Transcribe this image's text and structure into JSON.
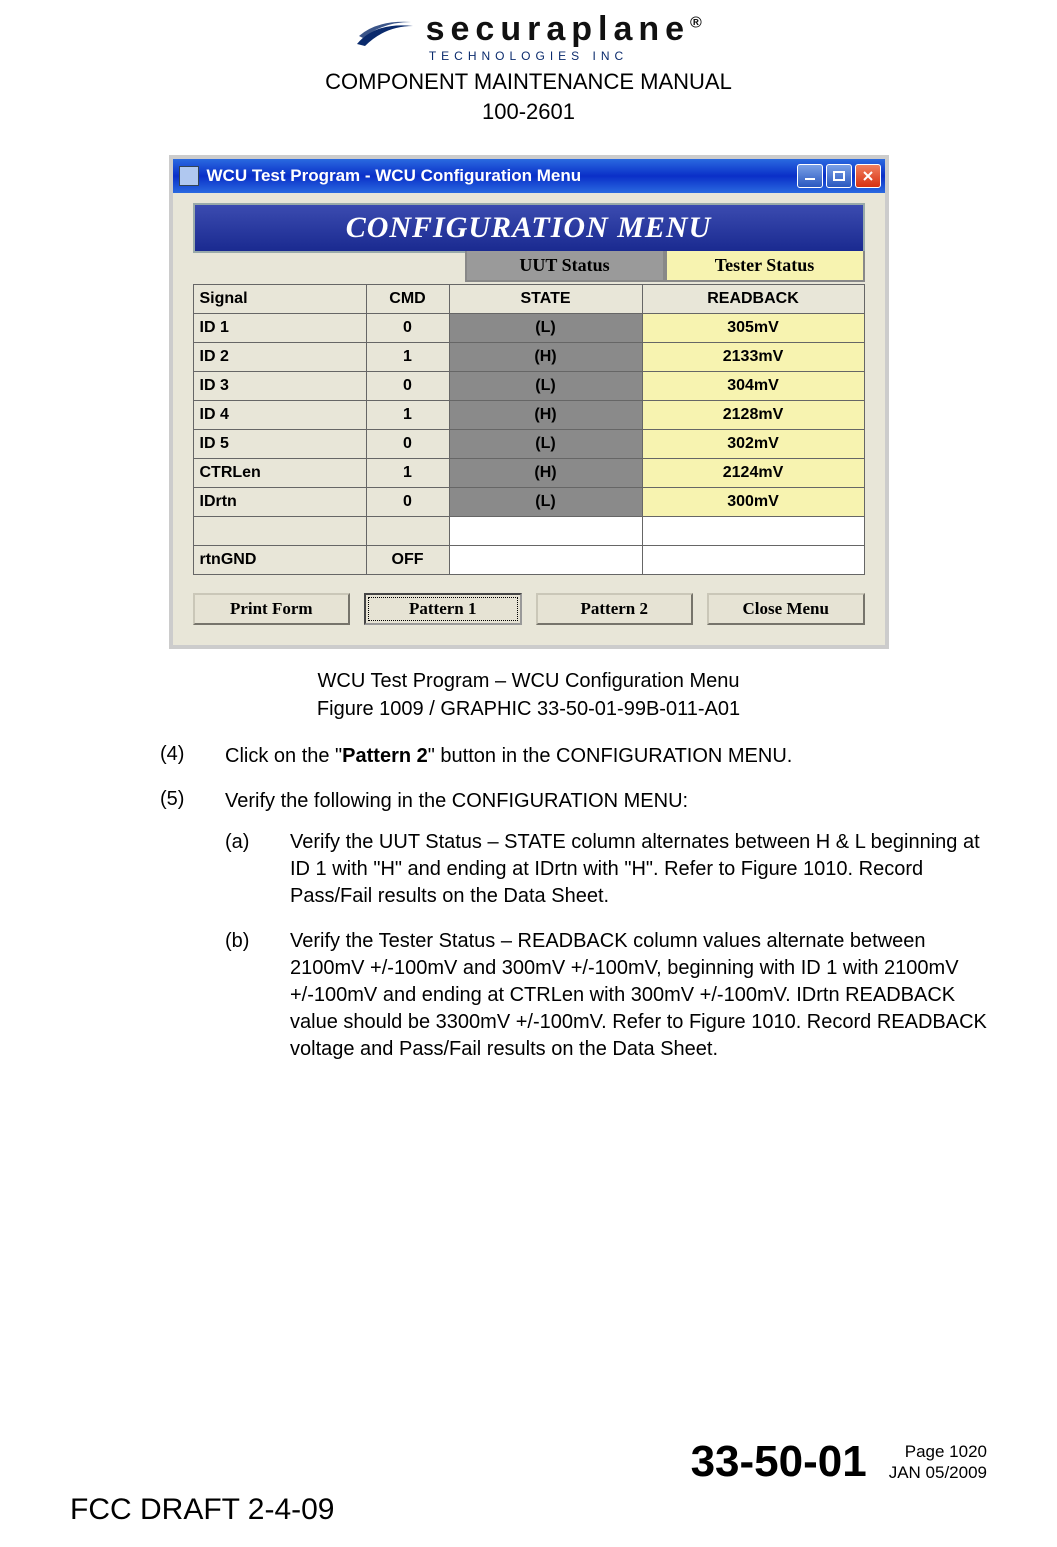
{
  "header": {
    "logo_brand": "securaplane",
    "logo_reg": "®",
    "logo_subtitle": "TECHNOLOGIES INC",
    "line1": "COMPONENT MAINTENANCE MANUAL",
    "line2": "100-2601"
  },
  "window": {
    "title": "WCU Test Program - WCU Configuration Menu",
    "config_heading": "CONFIGURATION MENU",
    "status_tabs": {
      "uut": "UUT Status",
      "tester": "Tester Status"
    },
    "columns": {
      "signal": "Signal",
      "cmd": "CMD",
      "state": "STATE",
      "readback": "READBACK"
    },
    "rows": [
      {
        "signal": "ID 1",
        "cmd": "0",
        "state": "(L)",
        "readback": "305mV"
      },
      {
        "signal": "ID 2",
        "cmd": "1",
        "state": "(H)",
        "readback": "2133mV"
      },
      {
        "signal": "ID 3",
        "cmd": "0",
        "state": "(L)",
        "readback": "304mV"
      },
      {
        "signal": "ID 4",
        "cmd": "1",
        "state": "(H)",
        "readback": "2128mV"
      },
      {
        "signal": "ID 5",
        "cmd": "0",
        "state": "(L)",
        "readback": "302mV"
      },
      {
        "signal": "CTRLen",
        "cmd": "1",
        "state": "(H)",
        "readback": "2124mV"
      },
      {
        "signal": "IDrtn",
        "cmd": "0",
        "state": "(L)",
        "readback": "300mV"
      },
      {
        "signal": "",
        "cmd": "",
        "state": "",
        "readback": ""
      },
      {
        "signal": "rtnGND",
        "cmd": "OFF",
        "state": "",
        "readback": ""
      }
    ],
    "buttons": {
      "print": "Print Form",
      "pattern1": "Pattern 1",
      "pattern2": "Pattern 2",
      "close": "Close Menu"
    }
  },
  "caption": {
    "line1": "WCU Test Program – WCU Configuration Menu",
    "line2": "Figure 1009 / GRAPHIC 33-50-01-99B-011-A01"
  },
  "steps": {
    "s4": {
      "num": "(4)",
      "pre": "Click on the \"",
      "bold": "Pattern 2",
      "post": "\" button in the CONFIGURATION MENU."
    },
    "s5": {
      "num": "(5)",
      "text": "Verify the following in the CONFIGURATION MENU:",
      "a": {
        "num": "(a)",
        "text": "Verify the UUT Status – STATE column alternates between H & L beginning at ID 1 with \"H\" and ending at IDrtn with \"H\". Refer to Figure 1010. Record Pass/Fail results on the Data Sheet."
      },
      "b": {
        "num": "(b)",
        "text": "Verify the Tester Status – READBACK column values alternate between 2100mV +/-100mV and 300mV +/-100mV, beginning with ID 1 with 2100mV +/-100mV and ending at CTRLen with 300mV +/-100mV. IDrtn READBACK value should be 3300mV +/-100mV. Refer to Figure 1010. Record READBACK voltage and Pass/Fail results on the Data Sheet."
      }
    }
  },
  "footer": {
    "chapter": "33-50-01",
    "page": "Page 1020",
    "date": "JAN 05/2009",
    "fcc": "FCC DRAFT 2-4-09"
  }
}
